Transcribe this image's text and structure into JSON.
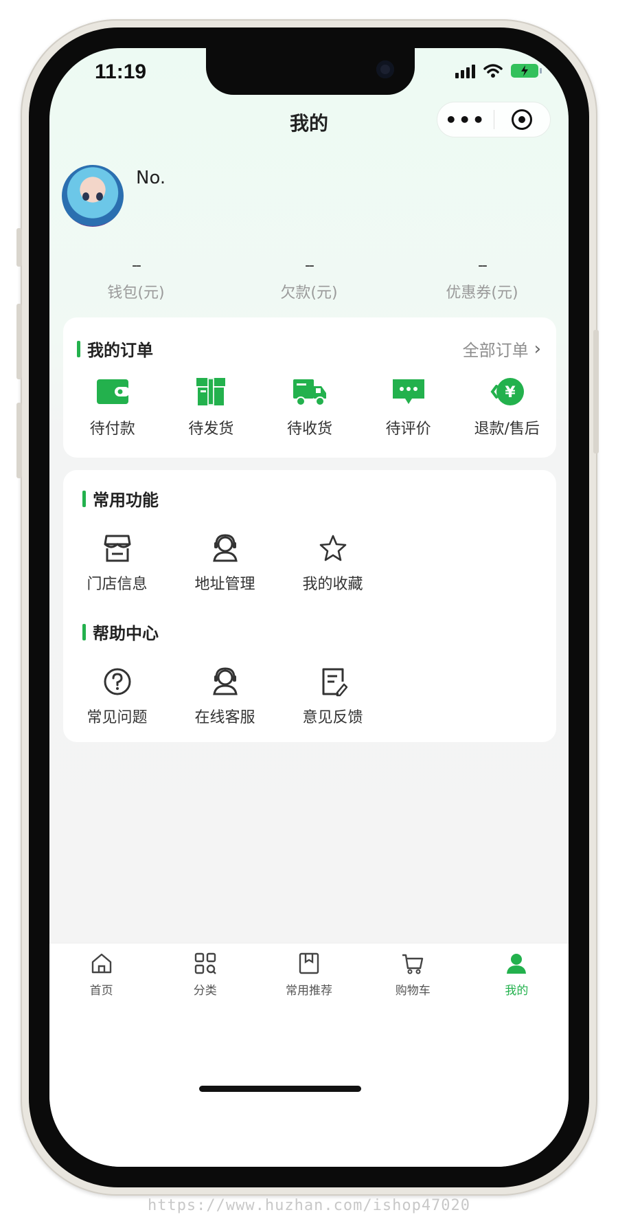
{
  "status_bar": {
    "time": "11:19"
  },
  "nav": {
    "title": "我的",
    "more_glyph": "•••"
  },
  "profile": {
    "name": "No."
  },
  "stats": [
    {
      "value": "--",
      "label": "钱包(元)"
    },
    {
      "value": "--",
      "label": "欠款(元)"
    },
    {
      "value": "--",
      "label": "优惠券(元)"
    }
  ],
  "orders": {
    "title": "我的订单",
    "all_link": "全部订单",
    "items": [
      {
        "icon": "wallet-icon",
        "label": "待付款"
      },
      {
        "icon": "package-icon",
        "label": "待发货"
      },
      {
        "icon": "truck-icon",
        "label": "待收货"
      },
      {
        "icon": "comment-icon",
        "label": "待评价"
      },
      {
        "icon": "refund-icon",
        "label": "退款/售后"
      }
    ]
  },
  "common_functions": {
    "title": "常用功能",
    "items": [
      {
        "icon": "store-icon",
        "label": "门店信息"
      },
      {
        "icon": "address-icon",
        "label": "地址管理"
      },
      {
        "icon": "star-icon",
        "label": "我的收藏"
      }
    ]
  },
  "help_center": {
    "title": "帮助中心",
    "items": [
      {
        "icon": "question-icon",
        "label": "常见问题"
      },
      {
        "icon": "headset-icon",
        "label": "在线客服"
      },
      {
        "icon": "feedback-icon",
        "label": "意见反馈"
      }
    ]
  },
  "tabbar": [
    {
      "icon": "home-icon",
      "label": "首页",
      "active": false
    },
    {
      "icon": "category-icon",
      "label": "分类",
      "active": false
    },
    {
      "icon": "recommend-icon",
      "label": "常用推荐",
      "active": false
    },
    {
      "icon": "cart-icon",
      "label": "购物车",
      "active": false
    },
    {
      "icon": "user-icon",
      "label": "我的",
      "active": true
    }
  ],
  "colors": {
    "accent": "#23b14d",
    "background": "#f4f4f4",
    "header_tint": "#edfaf3"
  },
  "watermark": "https://www.huzhan.com/ishop47020"
}
